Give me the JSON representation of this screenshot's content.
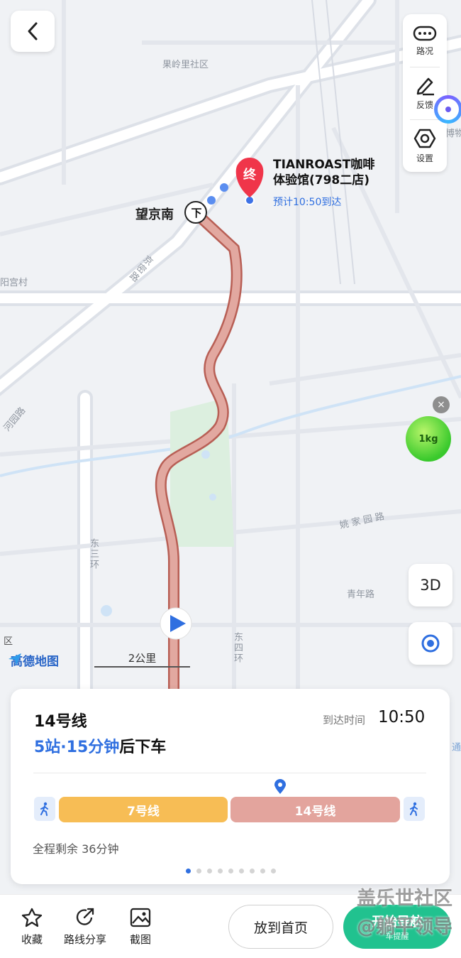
{
  "map": {
    "labels": {
      "guolingli": "果岭里社区",
      "yanggong": "阳宫村",
      "jingmi": "京密路",
      "dongsanhuan": "东三环",
      "dongsihuan": "东四环",
      "yaojiayuan": "姚家园路",
      "qingnian": "青年路",
      "heyuan": "河园路",
      "qu": "区",
      "tong": "通",
      "museum": "博物"
    },
    "station": "望京南",
    "station_badge": "下",
    "destination": {
      "badge": "终",
      "name_line1": "TIANROAST咖啡",
      "name_line2": "体验馆(798二店)",
      "eta": "预计10:50到达"
    },
    "brand": "高德地图",
    "scale": "2公里",
    "route_color": "#d49a93"
  },
  "controls": {
    "traffic": "路况",
    "feedback": "反馈",
    "settings": "设置",
    "three_d": "3D"
  },
  "bubble": {
    "label": "1kg",
    "close": "×"
  },
  "card": {
    "line_title": "14号线",
    "arrive_label": "到达时间",
    "arrive_time": "10:50",
    "summary_highlight": "5站·15分钟",
    "summary_rest": "后下车",
    "segments": [
      {
        "label": "7号线",
        "color": "#f7bd55"
      },
      {
        "label": "14号线",
        "color": "#e3a49d"
      }
    ],
    "remaining": "全程剩余 36分钟",
    "page_count": 9,
    "page_active": 0
  },
  "bottom": {
    "favorite": "收藏",
    "share": "路线分享",
    "screenshot": "截图",
    "home": "放到首页",
    "nav": "开始导航",
    "nav_sub": "车提醒"
  },
  "watermark": {
    "line1": "盖乐世社区",
    "line2": "@躺平领导"
  }
}
